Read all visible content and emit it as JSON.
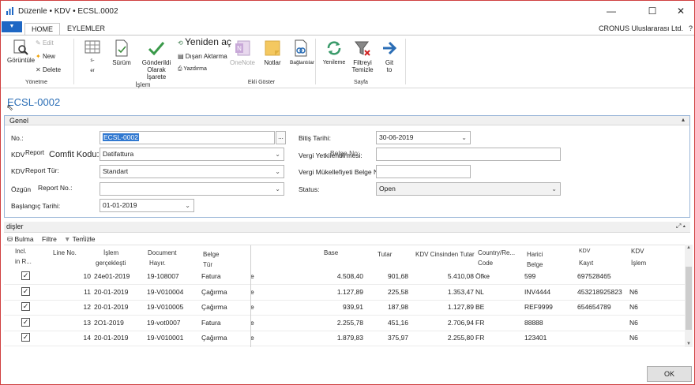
{
  "window": {
    "title": "Düzenle • KDV • ECSL.0002",
    "minimize": "—",
    "maximize": "☐",
    "close": "✕"
  },
  "tabs": {
    "app_menu": "▼",
    "home": "HOME",
    "actions": "EYLEMLER",
    "company": "CRONUS Uluslararası Ltd.",
    "help": "?"
  },
  "ribbon": {
    "view": "Görüntüle",
    "edit": "Edit",
    "new": "New",
    "delete": "Delete",
    "group_manage": "Yönetme",
    "suggest_line1": "s-",
    "suggest_line2": "er",
    "release": "Sürüm",
    "mark_sent": "Gönderildi",
    "mark_sent2": "Olarak İşarete",
    "reopen": "Yeniden aç",
    "export": "Dışarı Aktarma",
    "print": "Yazdırma",
    "group_process": "İşlem",
    "onenote": "OneNote",
    "notes": "Notlar",
    "links": "Bağlantılar",
    "group_show_attached": "Ekli Göster",
    "refresh": "Yenileme",
    "clear_filter": "Filtreyi",
    "clear_filter2": "Temizle",
    "goto": "Git",
    "goto2": "to",
    "group_page": "Sayfa"
  },
  "page_title": "ECSL-0002",
  "general": {
    "section_title": "Genel",
    "collapse": "▴",
    "no_label": "No.:",
    "no_value": "ECSL-0002",
    "ellipsis": "...",
    "report_label_a": "KDV",
    "report_label_b": "Report",
    "comfit_overlay": "Comfit Kodu:",
    "report_value": "Datifattura",
    "type_label_a": "KDV",
    "type_label_b": "Report Tür:",
    "type_value": "Standart",
    "own_label_a": "Özgün",
    "own_label_b": "Report No.:",
    "own_value": "",
    "start_label": "Başlangıç Tarihi:",
    "start_value": "01-01-2019",
    "end_label": "Bitiş Tarihi:",
    "end_value": "30-06-2019",
    "tax_auth_label": "Vergi Yetkilendirmesi:",
    "tax_auth_overlay": "Belge No:",
    "tax_auth_value": "",
    "taxpayer_label": "Vergi Mükellefiyeti Belge No:",
    "taxpayer_value": "",
    "status_label": "Status:",
    "status_value": "Open",
    "dd": "⌄"
  },
  "lines": {
    "section_title": "dişler",
    "header_ctl": "⤢ ▴",
    "find": "Bulma",
    "filter": "Filtre",
    "clear": "Temizle",
    "clear_overlay": "ilter"
  },
  "columns": {
    "incl_a": "Incl.",
    "incl_b": "in R...",
    "line_no": "Line No.",
    "posting_a": "İşlem",
    "posting_b": "gerçekleşti",
    "doc_a": "Document",
    "doc_b": "Hayır.",
    "doctype_a": "Belge",
    "doctype_b": "Tür",
    "base": "Base",
    "amount": "Tutar",
    "vat_lcy": "KDV Cinsinden Tutar",
    "country_a": "Country/Re...",
    "country_b": "Code",
    "ext_a": "Harici",
    "ext_b": "Belge",
    "vatreg_a": "KDV",
    "vatreg_b": "Kayıt",
    "vattx_a": "KDV",
    "vattx_b": "İşlem"
  },
  "rows": [
    {
      "check": "✓",
      "line": "10",
      "date": "24e01-2019",
      "doc": "19-108007",
      "type": "Fatura",
      "trail": "e",
      "base": "4.508,40",
      "amount": "901,68",
      "vat": "5.410,08",
      "country": "Öfke",
      "ext": "599",
      "reg": "697528465",
      "tx": ""
    },
    {
      "check": "✓",
      "line": "11",
      "date": "20-01-2019",
      "doc": "19-V010004",
      "type": "Çağırma",
      "trail": "e",
      "base": "1.127,89",
      "amount": "225,58",
      "vat": "1.353,47",
      "country": "NL",
      "ext": "INV4444",
      "reg": "453218925823",
      "tx": "N6"
    },
    {
      "check": "✓",
      "line": "12",
      "date": "20-01-2019",
      "doc": "19-V010005",
      "type": "Çağırma",
      "trail": "e",
      "base": "939,91",
      "amount": "187,98",
      "vat": "1.127,89",
      "country": "BE",
      "ext": "REF9999",
      "reg": "654654789",
      "tx": "N6"
    },
    {
      "check": "✓",
      "line": "13",
      "date": "2O1-2019",
      "doc": "19-vot0007",
      "type": "Fatura",
      "trail": "e",
      "base": "2.255,78",
      "amount": "451,16",
      "vat": "2.706,94",
      "country": "FR",
      "ext": "88888",
      "reg": "",
      "tx": "N6"
    },
    {
      "check": "✓",
      "line": "14",
      "date": "20-01-2019",
      "doc": "19-V010001",
      "type": "Çağırma",
      "trail": "e",
      "base": "1.879,83",
      "amount": "375,97",
      "vat": "2.255,80",
      "country": "FR",
      "ext": "123401",
      "reg": "",
      "tx": "N6"
    }
  ],
  "footer": {
    "ok": "OK"
  },
  "colors": {
    "accent": "#1e67c4",
    "title_link": "#2a6db5",
    "window_border": "#d04040"
  }
}
